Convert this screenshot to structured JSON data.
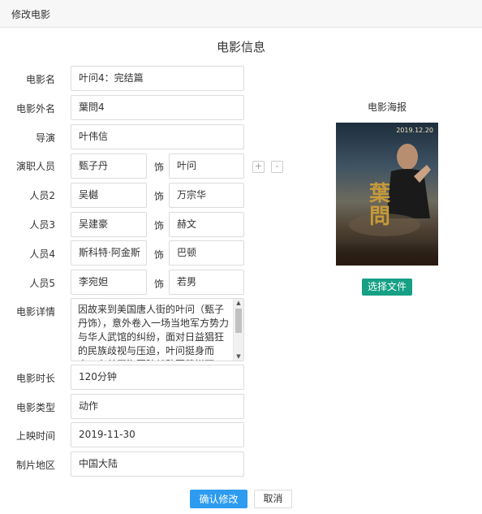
{
  "window": {
    "title": "修改电影"
  },
  "form": {
    "heading": "电影信息",
    "name": {
      "label": "电影名",
      "value": "叶问4：完结篇"
    },
    "foreign_name": {
      "label": "电影外名",
      "value": "葉問4"
    },
    "director": {
      "label": "导演",
      "value": "叶伟信"
    },
    "cast_label": "演职人员",
    "role_sep": "饰",
    "add_symbol": "+",
    "remove_symbol": "-",
    "cast": [
      {
        "label": "",
        "actor": "甄子丹",
        "role": "叶问"
      },
      {
        "label": "人员2",
        "actor": "吴樾",
        "role": "万宗华"
      },
      {
        "label": "人员3",
        "actor": "吴建豪",
        "role": "赫文"
      },
      {
        "label": "人员4",
        "actor": "斯科特·阿金斯",
        "role": "巴顿"
      },
      {
        "label": "人员5",
        "actor": "李宛妲",
        "role": "若男"
      }
    ],
    "details": {
      "label": "电影详情",
      "value": "因故来到美国唐人街的叶问（甄子丹饰），意外卷入一场当地军方势力与华人武馆的纠纷，面对日益猖狂的民族歧视与压迫，叶问挺身而出，在美国海军陆战队军营拼死一战，以正宗"
    },
    "duration": {
      "label": "电影时长",
      "value": "120分钟"
    },
    "genre": {
      "label": "电影类型",
      "value": "动作"
    },
    "release_date": {
      "label": "上映时间",
      "value": "2019-11-30"
    },
    "region": {
      "label": "制片地区",
      "value": "中国大陆"
    }
  },
  "poster": {
    "label": "电影海报",
    "date_text": "2019.12.20",
    "title_text": "葉問",
    "select_button": "选择文件"
  },
  "actions": {
    "confirm": "确认修改",
    "cancel": "取消"
  },
  "colors": {
    "confirm_bg": "#2d9cf0",
    "select_bg": "#16a085"
  }
}
